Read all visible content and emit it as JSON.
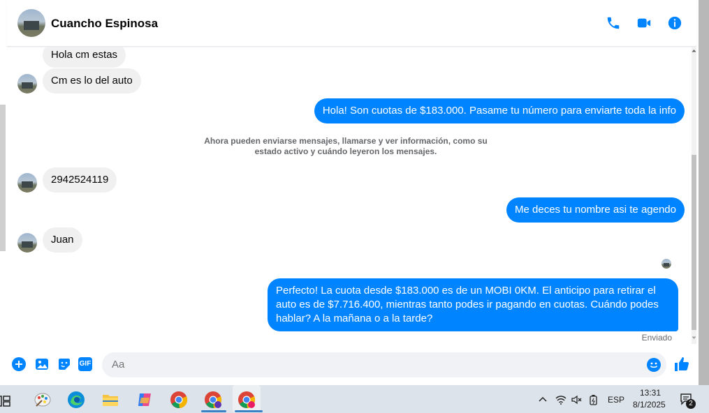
{
  "header": {
    "contact_name": "Cuancho Espinosa"
  },
  "messages": [
    {
      "id": "m1",
      "dir": "in",
      "text": "Hola cm estas"
    },
    {
      "id": "m2",
      "dir": "in",
      "text": "Cm es lo del auto"
    },
    {
      "id": "m3",
      "dir": "out",
      "text": "Hola! Son cuotas de $183.000. Pasame tu número para enviarte toda la info"
    },
    {
      "id": "m4",
      "dir": "in",
      "text": "2942524119"
    },
    {
      "id": "m5",
      "dir": "out",
      "text": "Me deces tu nombre asi te agendo"
    },
    {
      "id": "m6",
      "dir": "in",
      "text": "Juan"
    },
    {
      "id": "m7",
      "dir": "out",
      "text": "Perfecto! La cuota desde $183.000 es de un MOBI 0KM. El anticipo para retirar el auto es de $7.716.400, mientras tanto podes ir pagando en cuotas. Cuándo podes hablar? A la mañana o a la tarde?"
    }
  ],
  "notice": "Ahora pueden enviarse mensajes, llamarse y ver información, como su estado activo y cuándo leyeron los mensajes.",
  "status": "Enviado",
  "composer": {
    "placeholder": "Aa",
    "gif_label": "GIF"
  },
  "tray": {
    "language": "ESP",
    "time": "13:31",
    "date": "8/1/2025",
    "notifications": "2"
  },
  "colors": {
    "accent": "#0084ff",
    "incoming": "#f0f0f0"
  }
}
